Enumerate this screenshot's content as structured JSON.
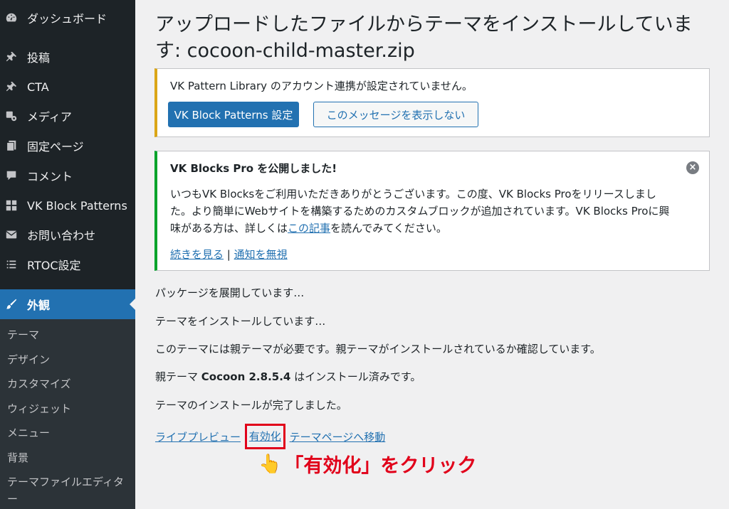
{
  "sidebar": {
    "items": [
      {
        "label": "ダッシュボード",
        "icon": "dashboard-icon"
      },
      {
        "label": "投稿",
        "icon": "pin-icon"
      },
      {
        "label": "CTA",
        "icon": "pin-icon"
      },
      {
        "label": "メディア",
        "icon": "media-icon"
      },
      {
        "label": "固定ページ",
        "icon": "page-icon"
      },
      {
        "label": "コメント",
        "icon": "comment-icon"
      },
      {
        "label": "VK Block Patterns",
        "icon": "grid-icon"
      },
      {
        "label": "お問い合わせ",
        "icon": "mail-icon"
      },
      {
        "label": "RTOC設定",
        "icon": "list-icon"
      },
      {
        "label": "外観",
        "icon": "brush-icon"
      }
    ],
    "submenu": [
      "テーマ",
      "デザイン",
      "カスタマイズ",
      "ウィジェット",
      "メニュー",
      "背景",
      "テーマファイルエディター"
    ]
  },
  "main": {
    "title": "アップロードしたファイルからテーマをインストールしています: cocoon-child-master.zip",
    "notice_warning": {
      "text": "VK Pattern Library のアカウント連携が設定されていません。",
      "primary_button": "VK Block Patterns 設定",
      "secondary_button": "このメッセージを表示しない"
    },
    "notice_success": {
      "heading": "VK Blocks Pro を公開しました!",
      "body_1": "いつもVK Blocksをご利用いただきありがとうございます。この度、VK Blocks Proをリリースしました。より簡単にWebサイトを構築するためのカスタムブロックが追加されています。VK Blocks Proに興味がある方は、詳しくは",
      "body_link": "この記事",
      "body_2": "を読んでみてください。",
      "link_more": "続きを見る",
      "separator": "|",
      "link_ignore": "通知を無視",
      "dismiss": "×"
    },
    "log": {
      "line1": "パッケージを展開しています…",
      "line2": "テーマをインストールしています…",
      "line3": "このテーマには親テーマが必要です。親テーマがインストールされているか確認しています。",
      "line4_pre": "親テーマ ",
      "line4_bold": "Cocoon 2.8.5.4",
      "line4_post": " はインストール済みです。",
      "line5": "テーマのインストールが完了しました。"
    },
    "actions": {
      "preview": "ライブプレビュー",
      "activate": "有効化",
      "theme_page": "テーマページへ移動"
    },
    "callout": {
      "hand": "👆",
      "text": "「有効化」をクリック"
    }
  },
  "colors": {
    "sidebar_bg": "#1d2327",
    "accent": "#2271b1",
    "warning": "#dba617",
    "success": "#00a32a",
    "highlight": "#e1001a"
  }
}
